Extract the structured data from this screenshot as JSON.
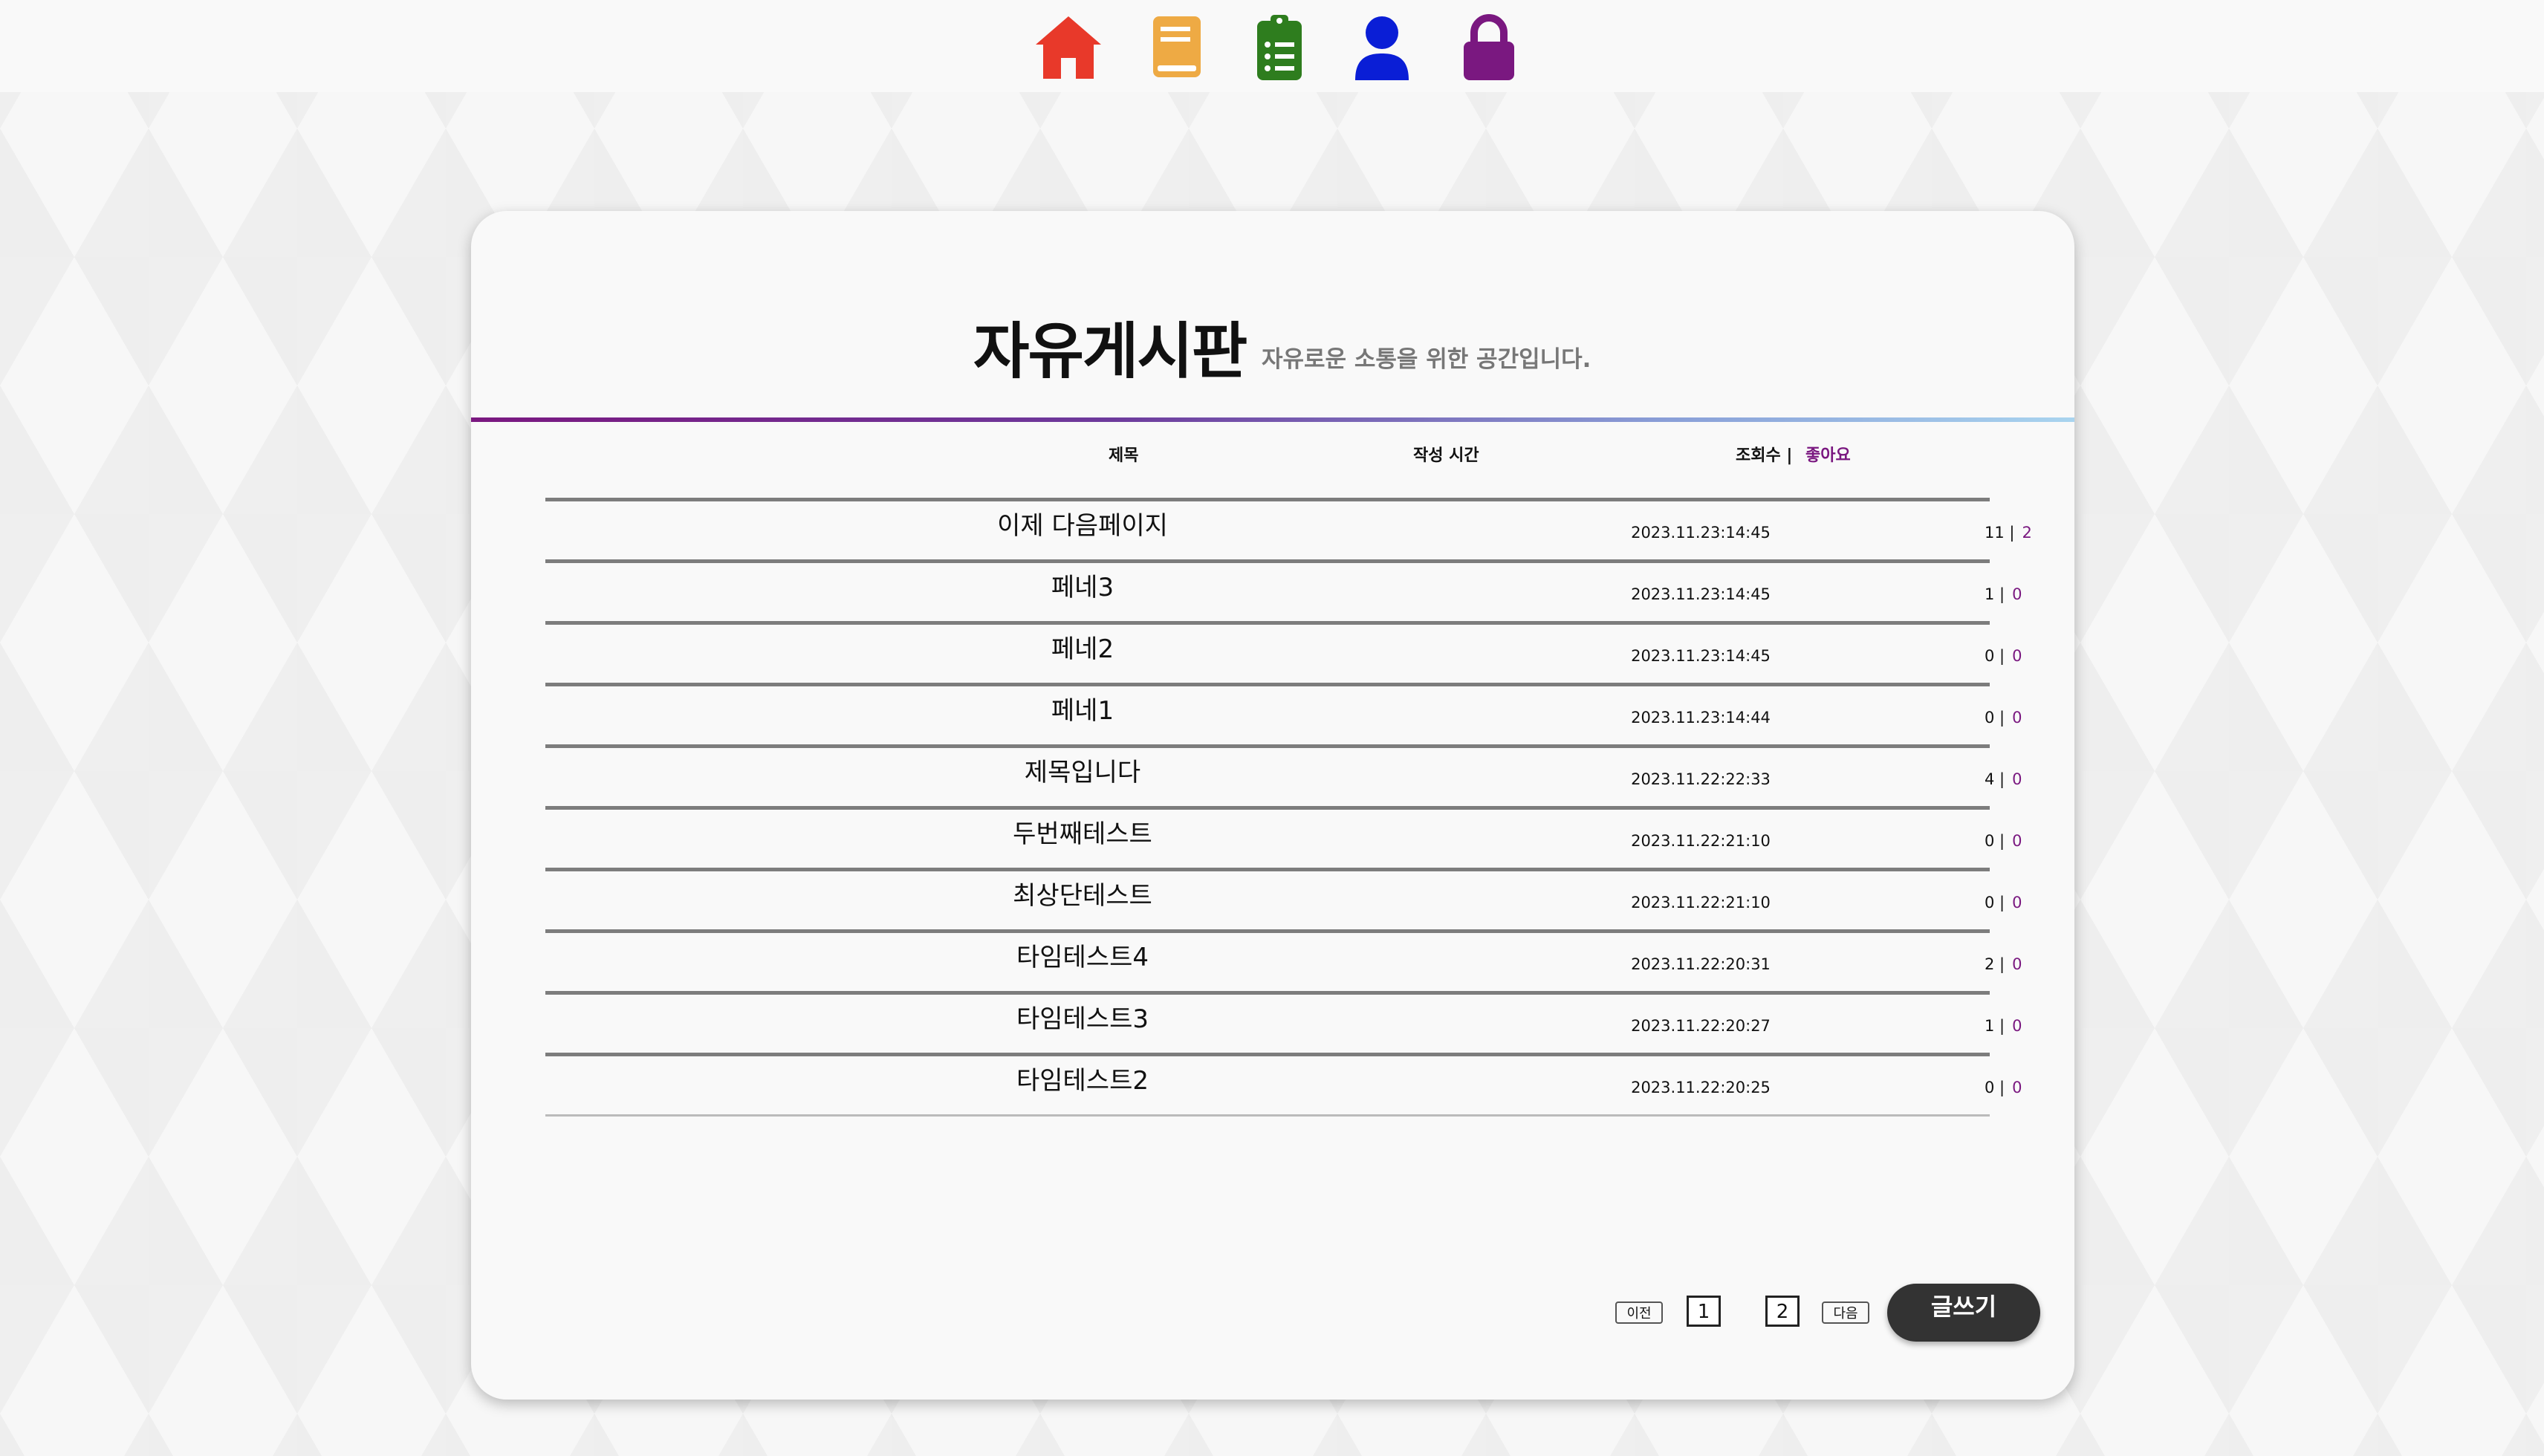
{
  "nav": {
    "icons": [
      {
        "name": "home-icon",
        "color": "#e8392a"
      },
      {
        "name": "book-icon",
        "color": "#eeaa44"
      },
      {
        "name": "clipboard-list-icon",
        "color": "#2e7d1e"
      },
      {
        "name": "user-icon",
        "color": "#0a1ed6"
      },
      {
        "name": "lock-icon",
        "color": "#7a1880"
      }
    ]
  },
  "board": {
    "title": "자유게시판",
    "subtitle": "자유로운 소통을 위한 공간입니다."
  },
  "table": {
    "headers": {
      "title": "제목",
      "time": "작성 시간",
      "views": "조회수 |",
      "likes": "좋아요"
    },
    "rows": [
      {
        "title": "이제 다음페이지",
        "time": "2023.11.23:14:45",
        "views": "11 |",
        "likes": "2"
      },
      {
        "title": "페네3",
        "time": "2023.11.23:14:45",
        "views": "1 |",
        "likes": "0"
      },
      {
        "title": "페네2",
        "time": "2023.11.23:14:45",
        "views": "0 |",
        "likes": "0"
      },
      {
        "title": "페네1",
        "time": "2023.11.23:14:44",
        "views": "0 |",
        "likes": "0"
      },
      {
        "title": "제목입니다",
        "time": "2023.11.22:22:33",
        "views": "4 |",
        "likes": "0"
      },
      {
        "title": "두번째테스트",
        "time": "2023.11.22:21:10",
        "views": "0 |",
        "likes": "0"
      },
      {
        "title": "최상단테스트",
        "time": "2023.11.22:21:10",
        "views": "0 |",
        "likes": "0"
      },
      {
        "title": "타임테스트4",
        "time": "2023.11.22:20:31",
        "views": "2 |",
        "likes": "0"
      },
      {
        "title": "타임테스트3",
        "time": "2023.11.22:20:27",
        "views": "1 |",
        "likes": "0"
      },
      {
        "title": "타임테스트2",
        "time": "2023.11.22:20:25",
        "views": "0 |",
        "likes": "0"
      }
    ]
  },
  "pagination": {
    "prev_label": "이전",
    "pages": [
      "1",
      "2"
    ],
    "next_label": "다음"
  },
  "actions": {
    "write_label": "글쓰기"
  },
  "colors": {
    "accent": "#7a1880",
    "write_button": "#333333"
  }
}
